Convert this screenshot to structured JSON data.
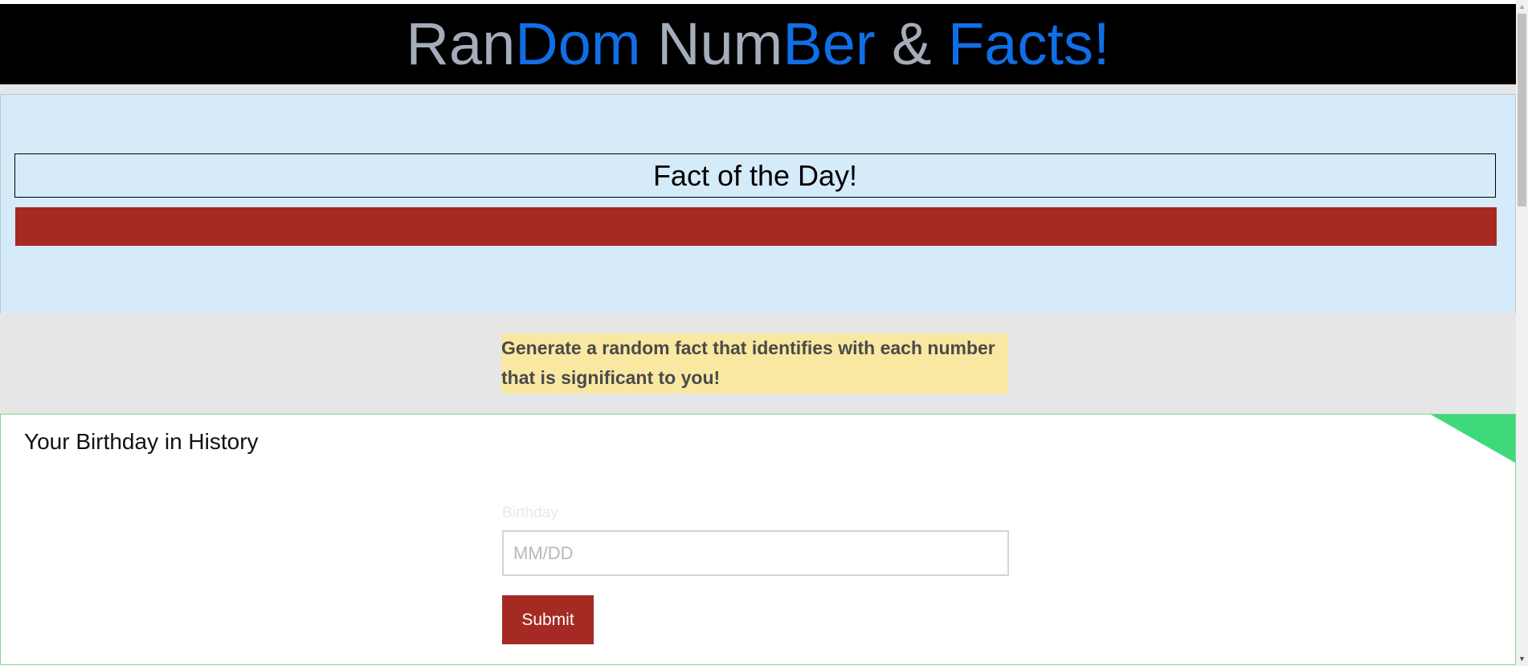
{
  "header": {
    "title_parts": [
      {
        "text": "Ran",
        "color": "grey"
      },
      {
        "text": "Dom",
        "color": "blue"
      },
      {
        "text": " Num",
        "color": "grey"
      },
      {
        "text": "Ber",
        "color": "blue"
      },
      {
        "text": " & ",
        "color": "grey"
      },
      {
        "text": "Facts!",
        "color": "blue"
      }
    ]
  },
  "fact_of_day": {
    "title": "Fact of the Day!",
    "content": ""
  },
  "intro": {
    "text": "Generate a random fact that identifies with each number that is significant to you!"
  },
  "birthday_card": {
    "title": "Your Birthday in History",
    "field_label": "Birthday",
    "input_value": "",
    "input_placeholder": "MM/DD",
    "submit_label": "Submit"
  },
  "scrollbar": {
    "up_icon": "triangle-up-icon",
    "down_icon": "triangle-down-icon"
  },
  "colors": {
    "header_bg": "#000000",
    "title_grey": "#a4adb9",
    "title_blue": "#0f6fe6",
    "fact_bg": "#d6ebfa",
    "fact_bar": "#a42a23",
    "intro_bg": "#f8e8a2",
    "section_grey": "#e6e6e6",
    "corner_green": "#3fd97a",
    "submit_bg": "#a42a23"
  }
}
